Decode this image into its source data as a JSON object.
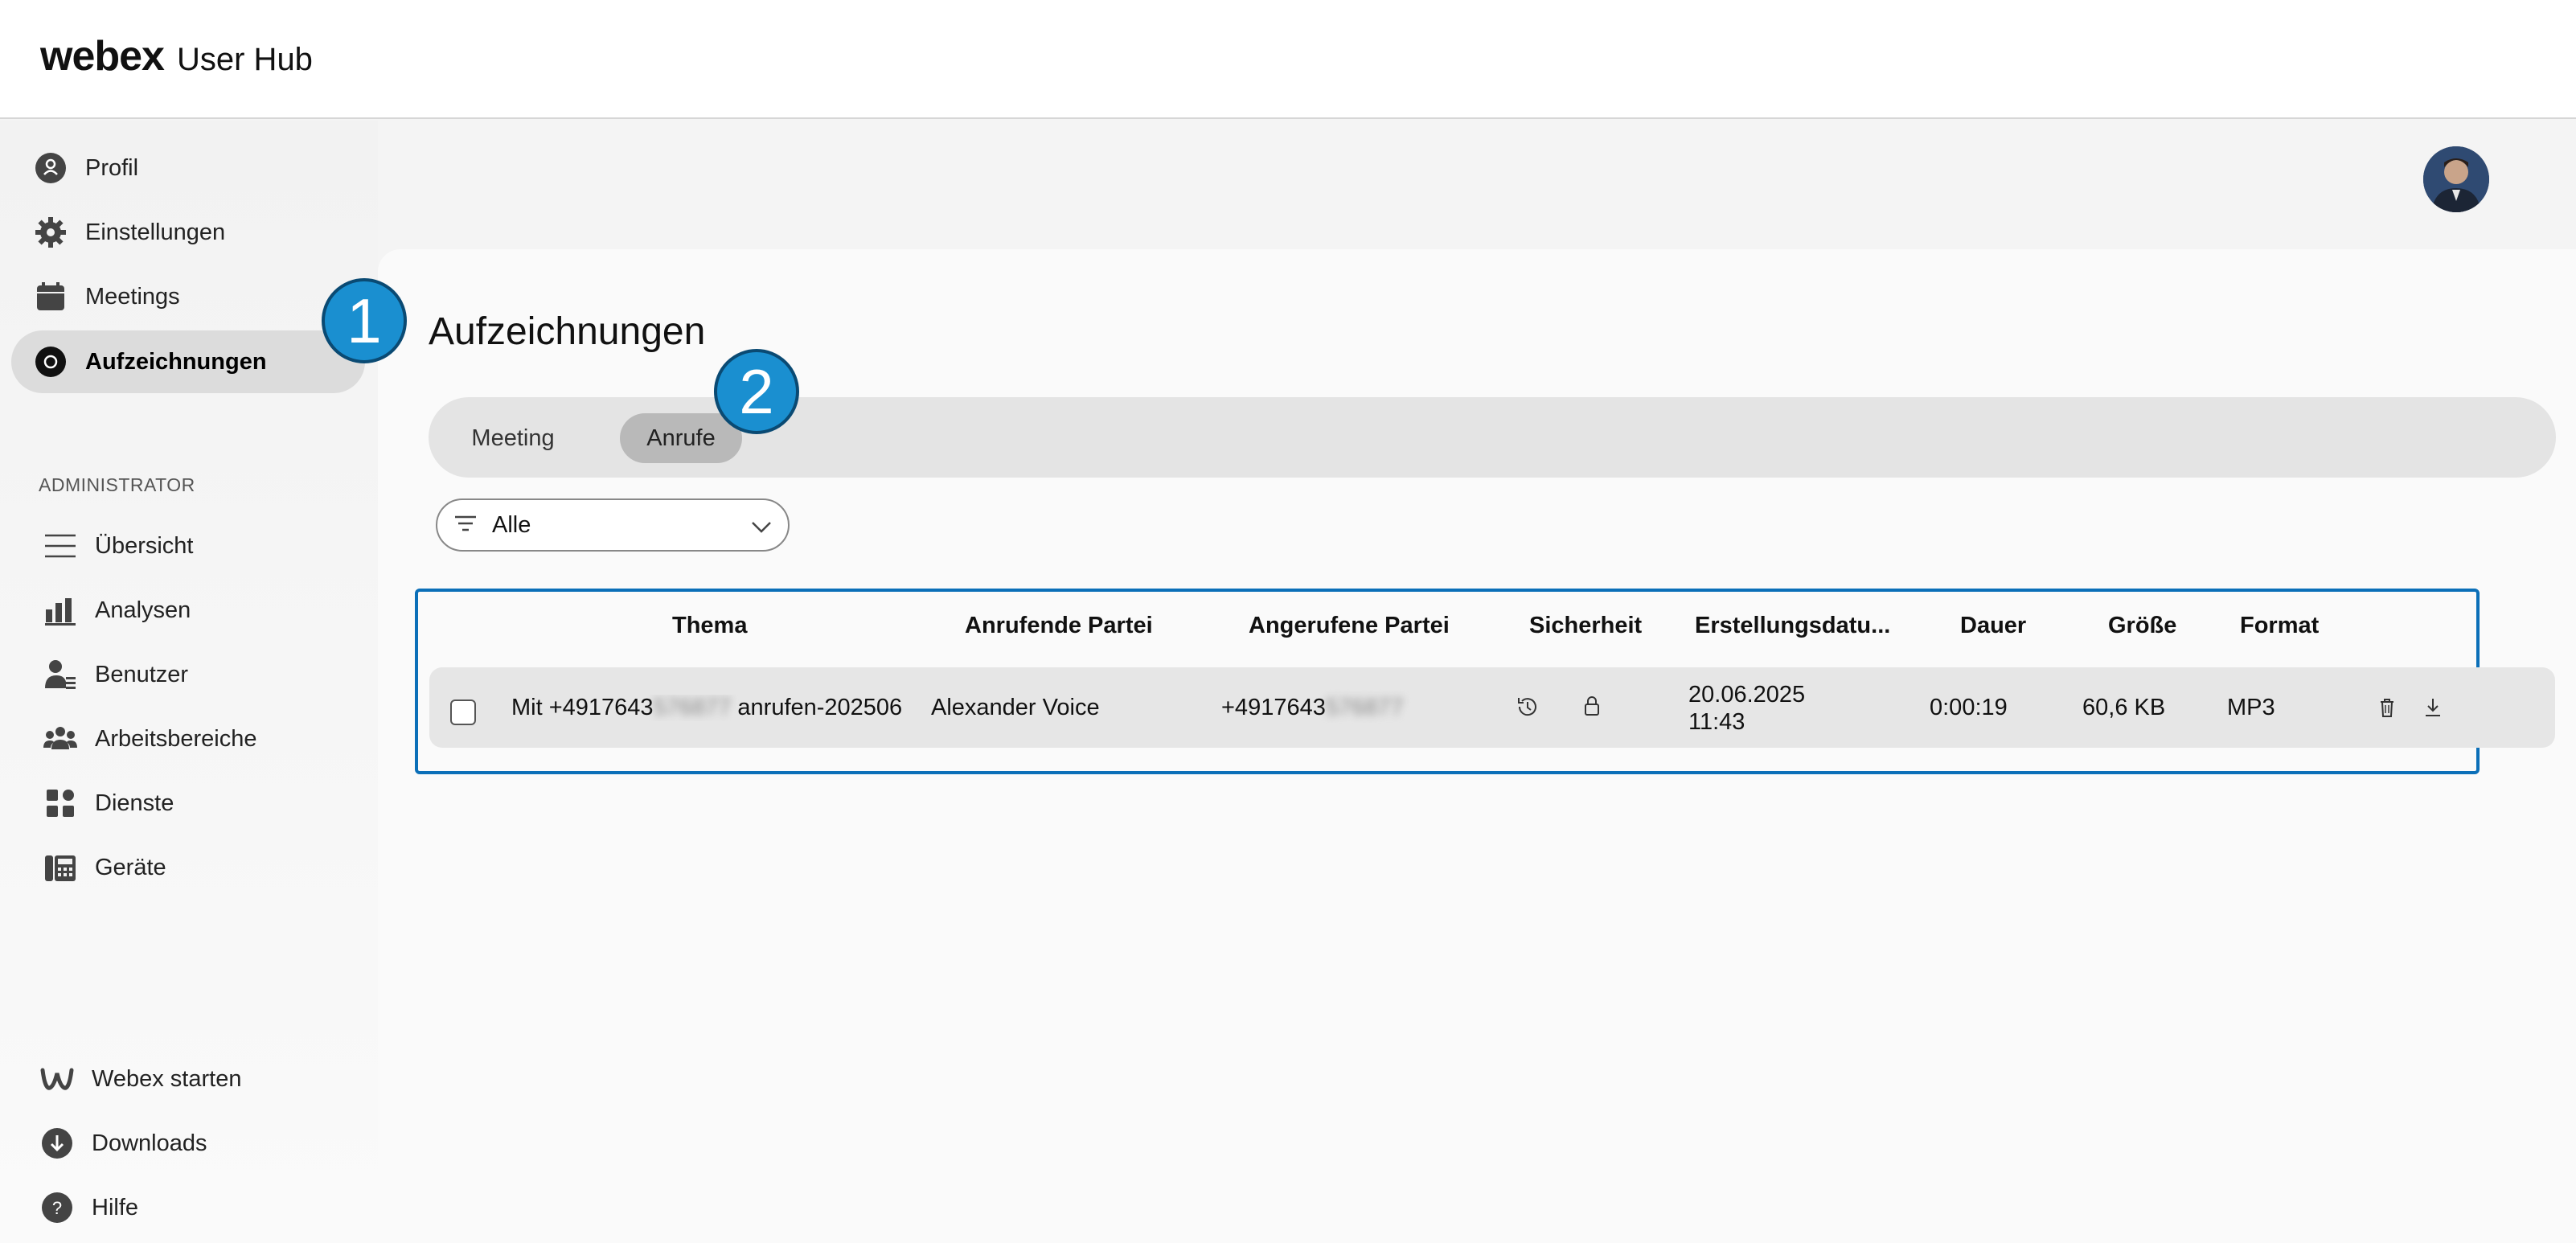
{
  "app": {
    "brand": "webex",
    "subtitle": "User Hub"
  },
  "sidebar": {
    "items": [
      {
        "label": "Profil",
        "icon": "user-icon"
      },
      {
        "label": "Einstellungen",
        "icon": "gear-icon"
      },
      {
        "label": "Meetings",
        "icon": "calendar-icon"
      },
      {
        "label": "Aufzeichnungen",
        "icon": "record-icon",
        "active": true
      }
    ],
    "admin_label": "ADMINISTRATOR",
    "admin_items": [
      {
        "label": "Übersicht",
        "icon": "menu-icon"
      },
      {
        "label": "Analysen",
        "icon": "bar-chart-icon"
      },
      {
        "label": "Benutzer",
        "icon": "user-list-icon"
      },
      {
        "label": "Arbeitsbereiche",
        "icon": "group-icon"
      },
      {
        "label": "Dienste",
        "icon": "services-icon"
      },
      {
        "label": "Geräte",
        "icon": "phone-icon"
      }
    ],
    "footer_items": [
      {
        "label": "Webex starten",
        "icon": "webex-logo-icon"
      },
      {
        "label": "Downloads",
        "icon": "download-icon"
      },
      {
        "label": "Hilfe",
        "icon": "help-icon"
      }
    ]
  },
  "main": {
    "title": "Aufzeichnungen",
    "tabs": [
      {
        "label": "Meeting",
        "selected": false
      },
      {
        "label": "Anrufe",
        "selected": true
      }
    ],
    "filter": {
      "selected": "Alle"
    },
    "table": {
      "columns": [
        "Thema",
        "Anrufende Partei",
        "Angerufene Partei",
        "Sicherheit",
        "Erstellungsdatu...",
        "Dauer",
        "Größe",
        "Format"
      ],
      "rows": [
        {
          "topic_prefix": "Mit +4917643",
          "topic_blurred": "576877",
          "topic_suffix": " anrufen-202506",
          "caller": "Alexander Voice",
          "callee_prefix": "+4917643",
          "callee_blurred": "576877",
          "date": "20.06.2025",
          "time": "11:43",
          "duration": "0:00:19",
          "size": "60,6 KB",
          "format": "MP3"
        }
      ]
    }
  },
  "callouts": [
    "1",
    "2"
  ],
  "colors": {
    "accent": "#0b6fb8",
    "callout": "#1a8fd0"
  }
}
